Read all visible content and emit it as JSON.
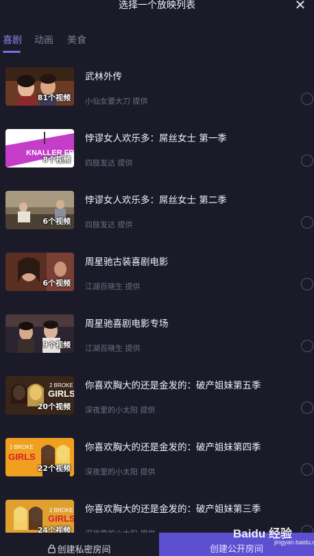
{
  "header": {
    "title": "选择一个放映列表",
    "close_label": "✕"
  },
  "tabs": [
    {
      "label": "喜剧",
      "active": true
    },
    {
      "label": "动画",
      "active": false
    },
    {
      "label": "美食",
      "active": false
    }
  ],
  "playlists": [
    {
      "name": "武林外传",
      "provider": "小仙女要大刀 提供",
      "count": "81个视频"
    },
    {
      "name": "悖谬女人欢乐多：屌丝女士 第一季",
      "provider": "四肢发达 提供",
      "count": "8个视频"
    },
    {
      "name": "悖谬女人欢乐多：屌丝女士 第二季",
      "provider": "四肢发达 提供",
      "count": "6个视频"
    },
    {
      "name": "周星驰古装喜剧电影",
      "provider": "江湖百晓生 提供",
      "count": "6个视频"
    },
    {
      "name": "周星驰喜剧电影专场",
      "provider": "江湖百晓生 提供",
      "count": "9个视频"
    },
    {
      "name": "你喜欢胸大的还是金发的：破产姐妹第五季",
      "provider": "深夜里的小太阳 提供",
      "count": "20个视频"
    },
    {
      "name": "你喜欢胸大的还是金发的：破产姐妹第四季",
      "provider": "深夜里的小太阳 提供",
      "count": "22个视频"
    },
    {
      "name": "你喜欢胸大的还是金发的：破产姐妹第三季",
      "provider": "深夜里的小太阳 提供",
      "count": "24个视频"
    }
  ],
  "thumb_text": {
    "knaller": "KNALLER FRAUEN",
    "broke_a": "2 BROKE",
    "broke_b": "GIRLS"
  },
  "footer": {
    "private_label": "创建私密房间",
    "public_label": "创建公开房间"
  },
  "watermark": {
    "brand": "Baidu 经验",
    "url": "jingyan.baidu.com"
  },
  "colors": {
    "background": "#1b1a29",
    "accent": "#7d6fe0",
    "public_button": "#5c4fd0"
  }
}
